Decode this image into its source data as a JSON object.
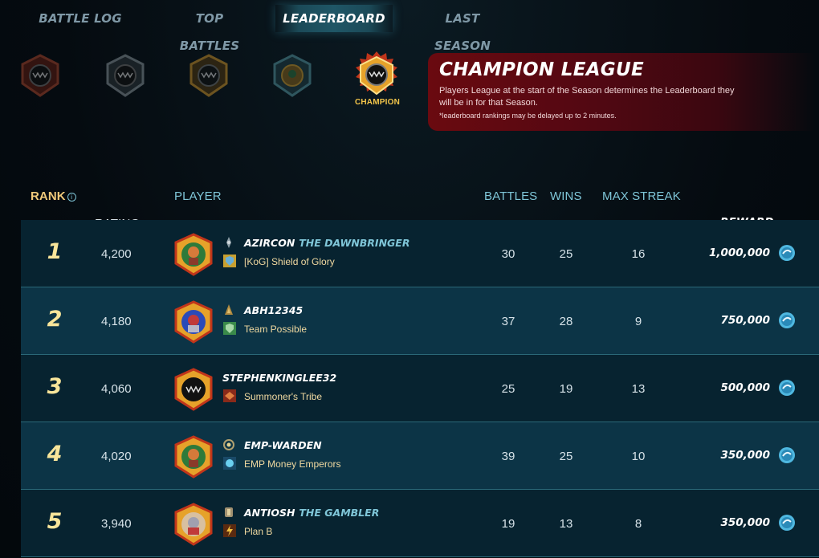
{
  "tabs": [
    {
      "label": "BATTLE LOG",
      "active": false
    },
    {
      "label": "TOP BATTLES",
      "active": false
    },
    {
      "label": "LEADERBOARD",
      "active": true
    },
    {
      "label": "LAST SEASON",
      "active": false
    }
  ],
  "leagues": {
    "selected_label": "CHAMPION"
  },
  "banner": {
    "title": "CHAMPION LEAGUE",
    "description": "Players League at the start of the Season determines the Leaderboard they will be in for that Season.",
    "note": "*leaderboard rankings may be delayed up to 2 minutes."
  },
  "table": {
    "headers": {
      "rank": "RANK",
      "rank_info": "i",
      "rating": "RATING",
      "player": "PLAYER",
      "battles": "BATTLES",
      "wins": "WINS",
      "max_streak": "MAX STREAK",
      "reward": "REWARD"
    },
    "rows": [
      {
        "rank": "1",
        "rating": "4,200",
        "name": "AZIRCON",
        "title": "THE DAWNBRINGER",
        "guild": "[KoG] Shield of Glory",
        "battles": "30",
        "wins": "25",
        "max_streak": "16",
        "reward": "1,000,000"
      },
      {
        "rank": "2",
        "rating": "4,180",
        "name": "ABH12345",
        "title": "",
        "guild": "Team Possible",
        "battles": "37",
        "wins": "28",
        "max_streak": "9",
        "reward": "750,000"
      },
      {
        "rank": "3",
        "rating": "4,060",
        "name": "STEPHENKINGLEE32",
        "title": "",
        "guild": "Summoner's Tribe",
        "battles": "25",
        "wins": "19",
        "max_streak": "13",
        "reward": "500,000"
      },
      {
        "rank": "4",
        "rating": "4,020",
        "name": "EMP-WARDEN",
        "title": "",
        "guild": "EMP Money Emperors",
        "battles": "39",
        "wins": "25",
        "max_streak": "10",
        "reward": "350,000"
      },
      {
        "rank": "5",
        "rating": "3,940",
        "name": "ANTIOSH",
        "title": "THE GAMBLER",
        "guild": "Plan B",
        "battles": "19",
        "wins": "13",
        "max_streak": "8",
        "reward": "350,000"
      }
    ]
  },
  "colors": {
    "accent": "#7fc6d8",
    "rank_gold": "#f8e59a",
    "banner_red": "#6a0a10"
  }
}
